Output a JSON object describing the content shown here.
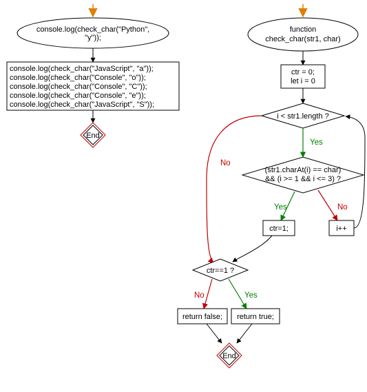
{
  "left": {
    "start_arrow_color": "#e08000",
    "call1": "console.log(check_char(\"Python\", \"y\"));",
    "stmts": [
      "console.log(check_char(\"JavaScript\", \"a\"));",
      "console.log(check_char(\"Console\", \"o\"));",
      "console.log(check_char(\"Console\", \"C\"));",
      "console.log(check_char(\"Console\", \"e\"));",
      "console.log(check_char(\"JavaScript\", \"S\"));"
    ],
    "end_label": "End"
  },
  "right": {
    "start_arrow_color": "#e08000",
    "func_line1": "function",
    "func_line2": "check_char(str1, char)",
    "init_line1": "ctr = 0;",
    "init_line2": "let i = 0",
    "cond_loop": "i < str1.length ?",
    "cond_char_line1": "(str1.charAt(i) == char)",
    "cond_char_line2": "&& (i >= 1 && i <= 3) ?",
    "set_ctr": "ctr=1;",
    "incr": "i++",
    "cond_ctr": "ctr==1 ?",
    "ret_false": "return false;",
    "ret_true": "return true;",
    "end_label": "End",
    "labels": {
      "yes": "Yes",
      "no": "No"
    }
  }
}
